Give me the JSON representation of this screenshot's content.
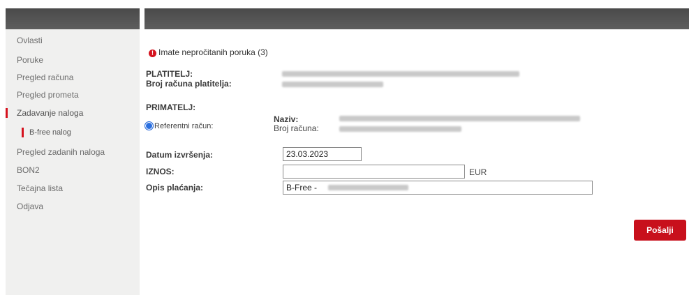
{
  "sidebar": {
    "items": [
      {
        "label": "Ovlasti"
      },
      {
        "label": "Poruke"
      },
      {
        "label": "Pregled računa"
      },
      {
        "label": "Pregled prometa"
      },
      {
        "label": "Zadavanje naloga"
      },
      {
        "label": "B-free nalog"
      },
      {
        "label": "Pregled zadanih naloga"
      },
      {
        "label": "BON2"
      },
      {
        "label": "Tečajna lista"
      },
      {
        "label": "Odjava"
      }
    ]
  },
  "main": {
    "message": "Imate nepročitanih poruka (3)",
    "payer_label": "PLATITELJ:",
    "payer_account_label": "Broj računa platitelja:",
    "recipient_label": "PRIMATELJ:",
    "reference_account_label": "Referentni račun:",
    "name_label": "Naziv:",
    "account_number_label": "Broj računa:",
    "execution_date_label": "Datum izvršenja:",
    "execution_date_value": "23.03.2023",
    "amount_label": "IZNOS:",
    "amount_value": "",
    "currency": "EUR",
    "description_label": "Opis plaćanja:",
    "description_value": "B-Free -",
    "submit_label": "Pošalji"
  },
  "colors": {
    "accent": "#c8101c",
    "header": "#555555",
    "sidebar_bg": "#f0f0ef"
  }
}
